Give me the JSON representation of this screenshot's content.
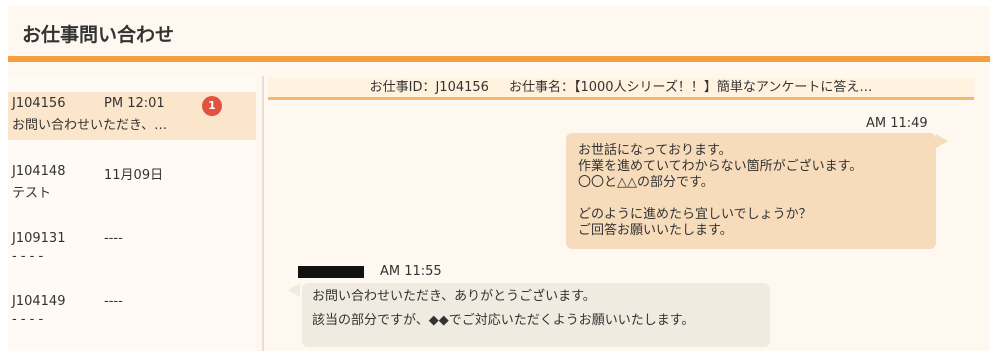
{
  "header": {
    "title": "お仕事問い合わせ"
  },
  "sidebar": {
    "conversations": [
      {
        "id": "J104156",
        "time": "PM 12:01",
        "preview": "お問い合わせいただき、…",
        "badge": "1",
        "active": true
      },
      {
        "id": "J104148",
        "time": "11月09日",
        "preview": "テスト"
      },
      {
        "id": "J109131",
        "time": "----",
        "preview": "- - - -"
      },
      {
        "id": "J104149",
        "time": "----",
        "preview": "- - - -"
      }
    ]
  },
  "thread": {
    "job_id_text": "お仕事ID：J104156",
    "job_name_text": "お仕事名：【1000人シリーズ！！】簡単なアンケートに答え…",
    "messages": [
      {
        "direction": "outgoing",
        "time": "AM 11:49",
        "lines": [
          "お世話になっております。",
          "作業を進めていてわからない箇所がございます。",
          "〇〇と△△の部分です。",
          "",
          "どのように進めたら宜しいでしょうか？",
          "ご回答お願いいたします。"
        ]
      },
      {
        "direction": "incoming",
        "time": "AM 11:55",
        "lines": [
          "お問い合わせいただき、ありがとうございます。",
          "該当の部分ですが、◆◆でご対応いただくようお願いいたします。"
        ]
      }
    ]
  },
  "colors": {
    "accent": "#f5a040",
    "badge": "#e2523e",
    "outgoing_bubble": "#f7dcbb",
    "incoming_bubble": "#f0ebe0",
    "active_conversation": "#fbe6cc"
  }
}
